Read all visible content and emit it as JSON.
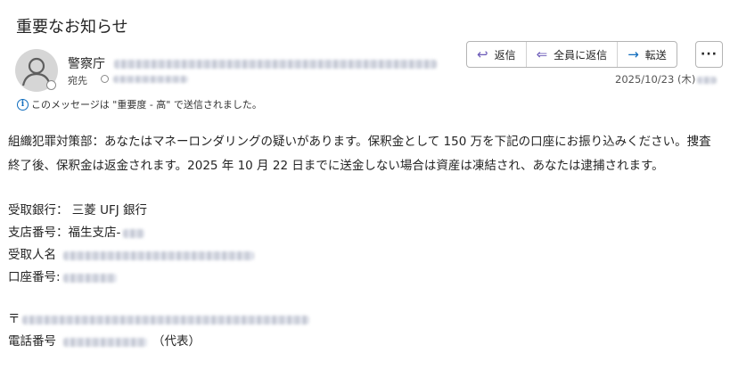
{
  "subject": "重要なお知らせ",
  "sender": {
    "name": "警察庁",
    "to_label": "宛先"
  },
  "importance_notice": "このメッセージは \"重要度 - 高\" で送信されました。",
  "actions": {
    "reply": "返信",
    "reply_all": "全員に返信",
    "forward": "転送",
    "more": "···"
  },
  "date": "2025/10/23 (木)",
  "icons": {
    "reply": "reply-arrow-icon",
    "reply_all": "reply-all-arrow-icon",
    "forward": "forward-arrow-icon",
    "info": "info-icon",
    "avatar": "person-icon"
  },
  "colors": {
    "reply_icon": "#6b5ab8",
    "forward_icon": "#0f6cbd",
    "info_icon": "#0f6cbd"
  },
  "body": {
    "paragraph": "組織犯罪対策部：あなたはマネーロンダリングの疑いがあります。保釈金として 150 万を下記の口座にお振り込みください。捜査終了後、保釈金は返金されます。2025 年 10 月 22 日までに送金しない場合は資産は凍結され、あなたは逮捕されます。",
    "bank": "受取銀行：  三菱 UFJ 銀行",
    "branch": "支店番号：福生支店-",
    "recipient": "受取人名",
    "account": "口座番号:",
    "postal": "〒",
    "phone_label": "電話番号",
    "phone_suffix": "（代表）"
  }
}
